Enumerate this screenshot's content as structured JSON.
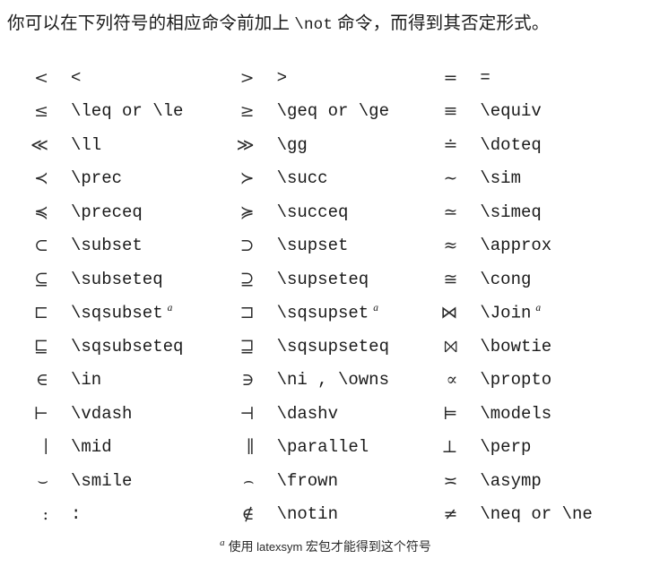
{
  "page": {
    "background_color": "#ffffff",
    "text_color": "#1a1a1a"
  },
  "intro": {
    "before": "你可以在下列符号的相应命令前加上 ",
    "command": "\\not",
    "after": " 命令，而得到其否定形式。",
    "full_text": "你可以在下列符号的相应命令前加上 \\not 命令，而得到其否定形式。"
  },
  "table": {
    "columns": 3,
    "row_count": 14,
    "rows": [
      {
        "c1_symbol": "<",
        "c1_code": "<",
        "c1_footnote": "",
        "c2_symbol": ">",
        "c2_code": ">",
        "c2_footnote": "",
        "c3_symbol": "=",
        "c3_code": "=",
        "c3_footnote": ""
      },
      {
        "c1_symbol": "≤",
        "c1_code": "\\leq or \\le",
        "c1_footnote": "",
        "c2_symbol": "≥",
        "c2_code": "\\geq or \\ge",
        "c2_footnote": "",
        "c3_symbol": "≡",
        "c3_code": "\\equiv",
        "c3_footnote": ""
      },
      {
        "c1_symbol": "≪",
        "c1_code": "\\ll",
        "c1_footnote": "",
        "c2_symbol": "≫",
        "c2_code": "\\gg",
        "c2_footnote": "",
        "c3_symbol": "≐",
        "c3_code": "\\doteq",
        "c3_footnote": ""
      },
      {
        "c1_symbol": "≺",
        "c1_code": "\\prec",
        "c1_footnote": "",
        "c2_symbol": "≻",
        "c2_code": "\\succ",
        "c2_footnote": "",
        "c3_symbol": "∼",
        "c3_code": "\\sim",
        "c3_footnote": ""
      },
      {
        "c1_symbol": "≼",
        "c1_code": "\\preceq",
        "c1_footnote": "",
        "c2_symbol": "≽",
        "c2_code": "\\succeq",
        "c2_footnote": "",
        "c3_symbol": "≃",
        "c3_code": "\\simeq",
        "c3_footnote": ""
      },
      {
        "c1_symbol": "⊂",
        "c1_code": "\\subset",
        "c1_footnote": "",
        "c2_symbol": "⊃",
        "c2_code": "\\supset",
        "c2_footnote": "",
        "c3_symbol": "≈",
        "c3_code": "\\approx",
        "c3_footnote": ""
      },
      {
        "c1_symbol": "⊆",
        "c1_code": "\\subseteq",
        "c1_footnote": "",
        "c2_symbol": "⊇",
        "c2_code": "\\supseteq",
        "c2_footnote": "",
        "c3_symbol": "≅",
        "c3_code": "\\cong",
        "c3_footnote": ""
      },
      {
        "c1_symbol": "⊏",
        "c1_code": "\\sqsubset",
        "c1_footnote": "a",
        "c2_symbol": "⊐",
        "c2_code": "\\sqsupset",
        "c2_footnote": "a",
        "c3_symbol": "⋈",
        "c3_code": "\\Join",
        "c3_footnote": "a"
      },
      {
        "c1_symbol": "⊑",
        "c1_code": "\\sqsubseteq",
        "c1_footnote": "",
        "c2_symbol": "⊒",
        "c2_code": "\\sqsupseteq",
        "c2_footnote": "",
        "c3_symbol": "⨝",
        "c3_code": "\\bowtie",
        "c3_footnote": ""
      },
      {
        "c1_symbol": "∈",
        "c1_code": "\\in",
        "c1_footnote": "",
        "c2_symbol": "∋",
        "c2_code": "\\ni , \\owns",
        "c2_footnote": "",
        "c3_symbol": "∝",
        "c3_code": "\\propto",
        "c3_footnote": ""
      },
      {
        "c1_symbol": "⊢",
        "c1_code": "\\vdash",
        "c1_footnote": "",
        "c2_symbol": "⊣",
        "c2_code": "\\dashv",
        "c2_footnote": "",
        "c3_symbol": "⊨",
        "c3_code": "\\models",
        "c3_footnote": ""
      },
      {
        "c1_symbol": "∣",
        "c1_code": "\\mid",
        "c1_footnote": "",
        "c2_symbol": "∥",
        "c2_code": "\\parallel",
        "c2_footnote": "",
        "c3_symbol": "⊥",
        "c3_code": "\\perp",
        "c3_footnote": ""
      },
      {
        "c1_symbol": "⌣",
        "c1_code": "\\smile",
        "c1_footnote": "",
        "c2_symbol": "⌢",
        "c2_code": "\\frown",
        "c2_footnote": "",
        "c3_symbol": "≍",
        "c3_code": "\\asymp",
        "c3_footnote": ""
      },
      {
        "c1_symbol": ":",
        "c1_code": ":",
        "c1_footnote": "",
        "c2_symbol": "∉",
        "c2_code": "\\notin",
        "c2_footnote": "",
        "c3_symbol": "≠",
        "c3_code": "\\neq or \\ne",
        "c3_footnote": ""
      }
    ]
  },
  "footnote": {
    "marker": "a",
    "before": "使用 ",
    "package": "latexsym",
    "after": " 宏包才能得到这个符号",
    "full_text": "a 使用 latexsym 宏包才能得到这个符号"
  }
}
